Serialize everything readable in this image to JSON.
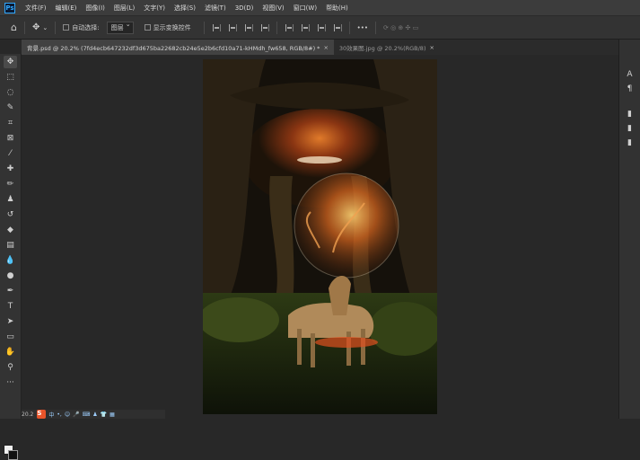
{
  "app": {
    "logo": "Ps"
  },
  "menu": [
    "文件(F)",
    "编辑(E)",
    "图像(I)",
    "图层(L)",
    "文字(Y)",
    "选择(S)",
    "滤镜(T)",
    "3D(D)",
    "视图(V)",
    "窗口(W)",
    "帮助(H)"
  ],
  "options_bar": {
    "auto_select_label": "自动选择:",
    "auto_select_value": "图层",
    "show_transform_label": "显示变换控件",
    "more": "•••"
  },
  "tabs": [
    {
      "label": "背景.psd @ 20.2% (7fd4ecb647232df3d675ba22682cb24e5e2b6cfd10a71-kHMdh_fw658, RGB/8#) *",
      "close": "×"
    },
    {
      "label": "30效果图.jpg @ 20.2%(RGB/8)",
      "close": "×"
    }
  ],
  "status": {
    "zoom": "20.2"
  },
  "colors": {
    "menubar": "#3c3c3c",
    "panel": "#333333",
    "canvas": "#282828",
    "accent": "#31a8ff"
  }
}
